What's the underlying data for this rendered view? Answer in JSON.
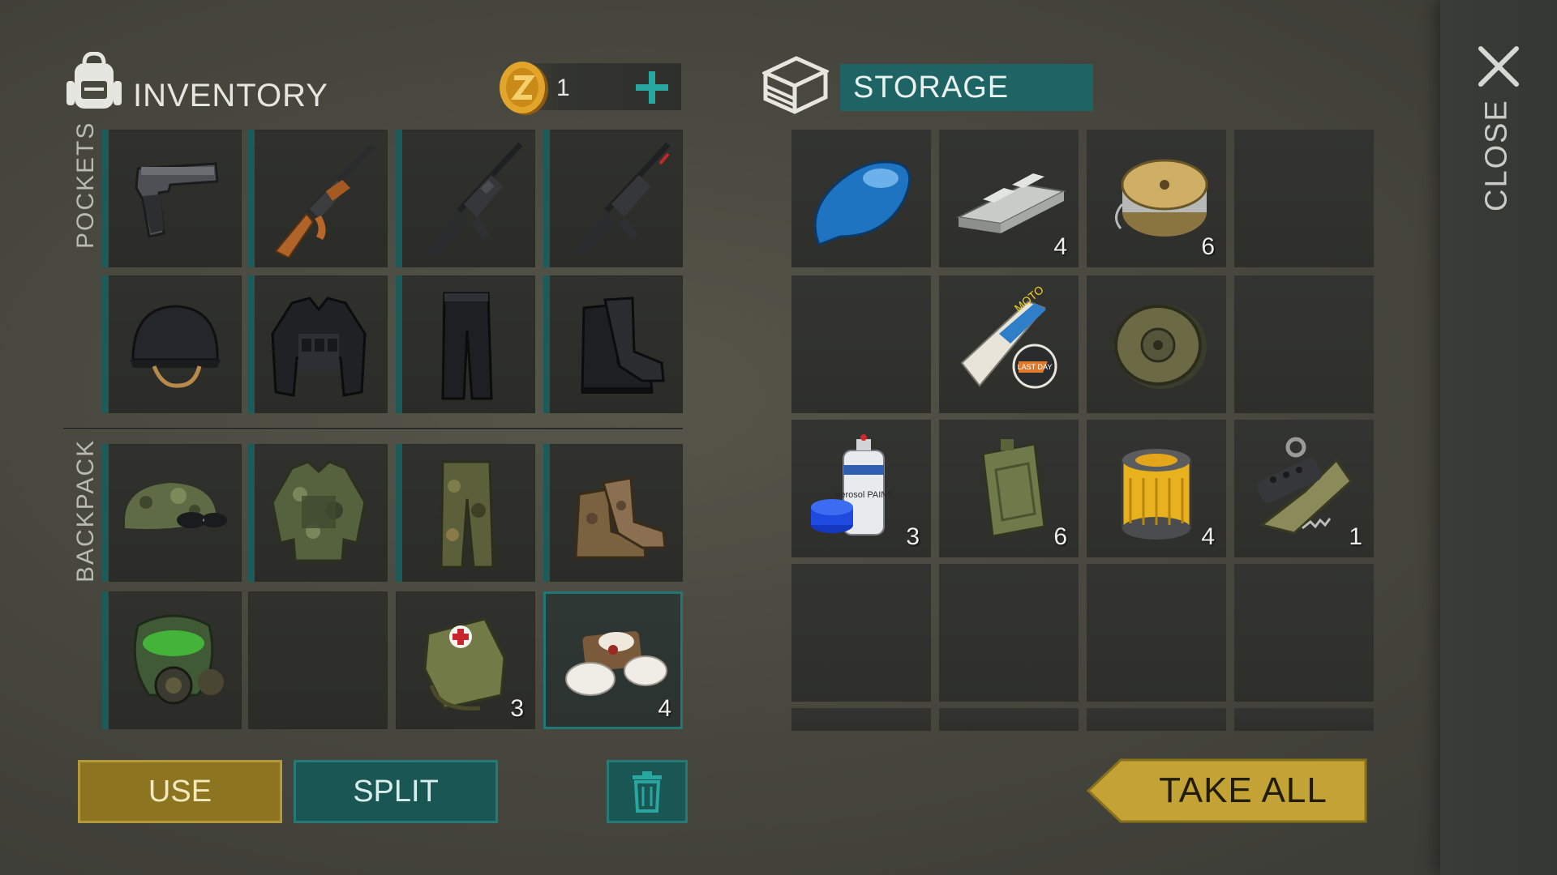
{
  "inventory": {
    "title": "INVENTORY",
    "coin_count": "1",
    "pockets_label": "POCKETS",
    "backpack_label": "BACKPACK",
    "pockets": [
      {
        "item": "pistol",
        "qty": ""
      },
      {
        "item": "ak-rifle",
        "qty": ""
      },
      {
        "item": "m4-rifle",
        "qty": ""
      },
      {
        "item": "m4-rifle-laser",
        "qty": ""
      },
      {
        "item": "helmet",
        "qty": ""
      },
      {
        "item": "tactical-vest",
        "qty": ""
      },
      {
        "item": "black-pants",
        "qty": ""
      },
      {
        "item": "black-boots",
        "qty": ""
      }
    ],
    "backpack": [
      {
        "item": "camo-cap",
        "qty": ""
      },
      {
        "item": "camo-jacket",
        "qty": ""
      },
      {
        "item": "camo-pants",
        "qty": ""
      },
      {
        "item": "camo-boots",
        "qty": ""
      },
      {
        "item": "gas-mask",
        "qty": ""
      },
      {
        "item": "empty",
        "qty": ""
      },
      {
        "item": "first-aid-bag",
        "qty": "3"
      },
      {
        "item": "bandage",
        "qty": "4"
      }
    ]
  },
  "storage": {
    "title": "STORAGE",
    "slots": [
      {
        "item": "blue-fuel-tank",
        "qty": ""
      },
      {
        "item": "metal-bars",
        "qty": "4"
      },
      {
        "item": "wire-spool",
        "qty": "6"
      },
      {
        "item": "empty",
        "qty": ""
      },
      {
        "item": "empty",
        "qty": ""
      },
      {
        "item": "moto-magazine",
        "qty": ""
      },
      {
        "item": "wheel-rim",
        "qty": ""
      },
      {
        "item": "empty",
        "qty": ""
      },
      {
        "item": "aerosol-paint",
        "qty": "3"
      },
      {
        "item": "jerry-can",
        "qty": "6"
      },
      {
        "item": "air-filter",
        "qty": "4"
      },
      {
        "item": "gun-parts",
        "qty": "1"
      }
    ],
    "magazine_text": "MOTO",
    "magazine_badge": "LAST DAY",
    "paint_text": "Aerosol PAINT"
  },
  "buttons": {
    "use": "USE",
    "split": "SPLIT",
    "take_all": "TAKE ALL",
    "close": "CLOSE"
  },
  "colors": {
    "accent_teal": "#1e6464",
    "gold": "#8c7420",
    "take_all_gold": "#c3a336"
  }
}
